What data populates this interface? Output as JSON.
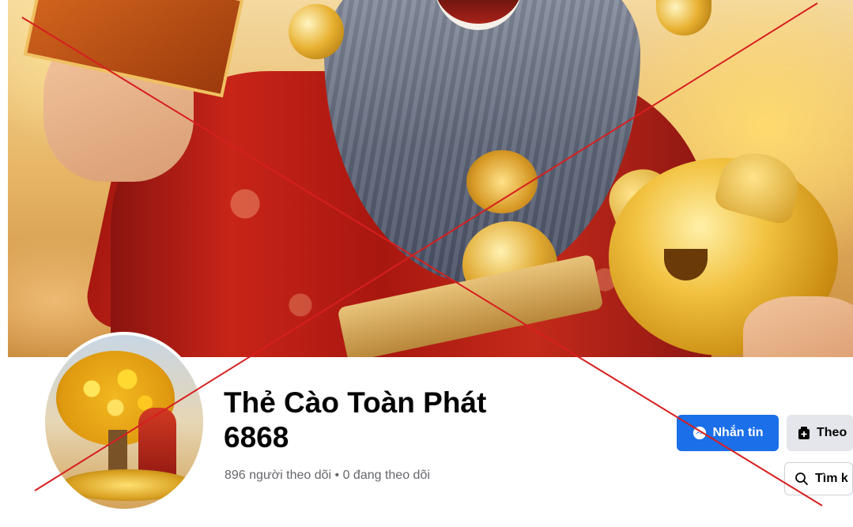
{
  "page": {
    "name": "Thẻ Cào Toàn Phát 6868",
    "followers_text": "896 người theo dõi • 0 đang theo dõi"
  },
  "actions": {
    "message_label": "Nhắn tin",
    "follow_label": "Theo",
    "search_label": "Tìm k"
  },
  "icons": {
    "message": "messenger-icon",
    "follow": "follow-page-icon",
    "search": "search-icon"
  },
  "colors": {
    "primary_button": "#1b6fe8",
    "secondary_button": "#e4e6eb",
    "cross_mark": "#d61f1f"
  }
}
